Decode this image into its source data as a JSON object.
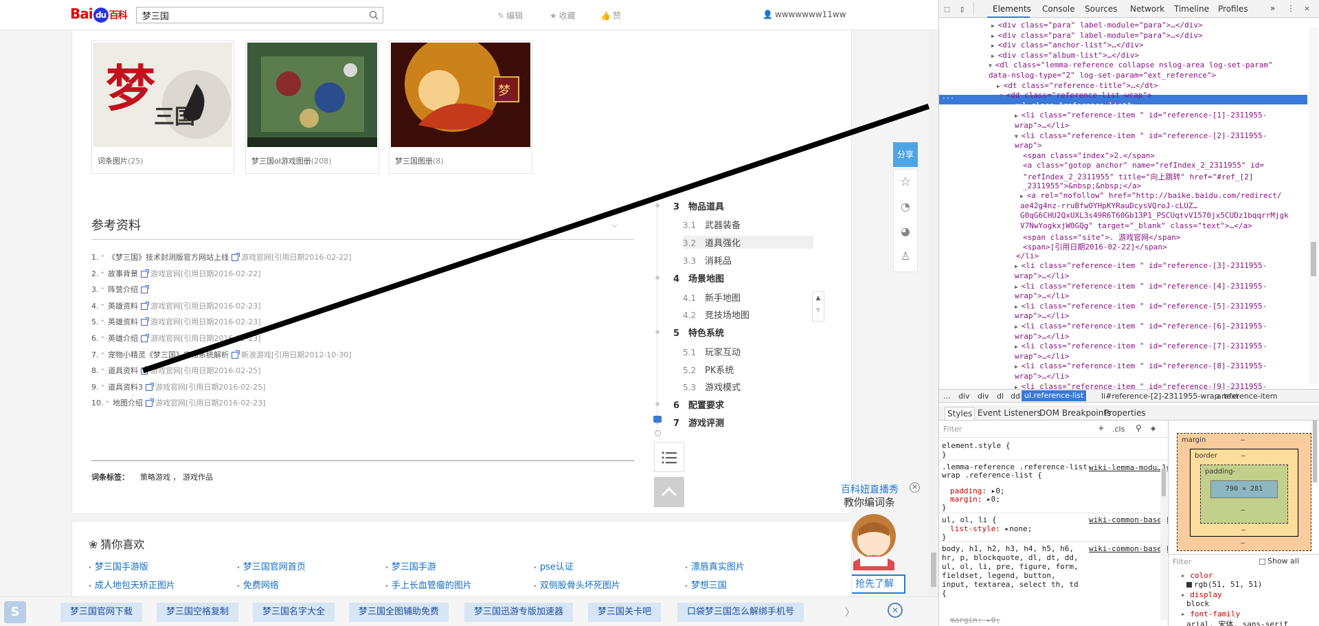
{
  "topbar": {
    "logo": "Bai",
    "logo_du": "du",
    "logo_baike": "百科",
    "search_value": "梦三国",
    "edit_label": "编辑",
    "favorite_label": "收藏",
    "like_label": "赞",
    "username": "wwwwwww11ww"
  },
  "albums": [
    {
      "caption": "词条图片",
      "count": "(25)"
    },
    {
      "caption": "梦三国ol游戏图册",
      "count": "(208)"
    },
    {
      "caption": "梦三国图册",
      "count": "(8)"
    }
  ],
  "references": {
    "title": "参考资料",
    "items": [
      {
        "num": "1.",
        "text": "《梦三国》技术封测版官方网站上线",
        "site": "游戏官网[引用日期2016-02-22]"
      },
      {
        "num": "2.",
        "text": "故事背景",
        "site": "游戏官网[引用日期2016-02-22]"
      },
      {
        "num": "3.",
        "text": "阵营介绍",
        "site": ""
      },
      {
        "num": "4.",
        "text": "英雄资料",
        "site": "游戏官网[引用日期2016-02-23]"
      },
      {
        "num": "5.",
        "text": "英雄资料",
        "site": "游戏官网[引用日期2016-02-23]"
      },
      {
        "num": "6.",
        "text": "英雄介绍",
        "site": "游戏官网[引用日期2016-02-23]"
      },
      {
        "num": "7.",
        "text": "宠物小精灵《梦三国》宠物系统解析",
        "site": "新浪游戏[引用日期2012-10-30]"
      },
      {
        "num": "8.",
        "text": "道具资料",
        "site": "游戏官网[引用日期2016-02-25]"
      },
      {
        "num": "9.",
        "text": "道具资料3",
        "site": "游戏官网[引用日期2016-02-25]"
      },
      {
        "num": "10.",
        "text": "地图介绍",
        "site": "游戏官网[引用日期2016-02-23]"
      }
    ]
  },
  "tags": {
    "label": "词条标签：",
    "values": "策略游戏 ， 游戏作品"
  },
  "toc": {
    "sections": [
      {
        "num": "3",
        "label": "物品道具",
        "minor": false
      },
      {
        "num": "3.1",
        "label": "武器装备",
        "minor": true
      },
      {
        "num": "3.2",
        "label": "道具强化",
        "minor": true
      },
      {
        "num": "3.3",
        "label": "消耗品",
        "minor": true
      },
      {
        "num": "4",
        "label": "场景地图",
        "minor": false
      },
      {
        "num": "4.1",
        "label": "新手地图",
        "minor": true
      },
      {
        "num": "4.2",
        "label": "竞技场地图",
        "minor": true
      },
      {
        "num": "5",
        "label": "特色系统",
        "minor": false
      },
      {
        "num": "5.1",
        "label": "玩家互动",
        "minor": true
      },
      {
        "num": "5.2",
        "label": "PK系统",
        "minor": true
      },
      {
        "num": "5.3",
        "label": "游戏模式",
        "minor": true
      },
      {
        "num": "6",
        "label": "配置要求",
        "minor": false
      },
      {
        "num": "7",
        "label": "游戏评测",
        "minor": false
      }
    ]
  },
  "share": {
    "label": "分享"
  },
  "live": {
    "title": "百科妞直播秀",
    "subtitle": "教你编词条",
    "button": "抢先了解"
  },
  "guess": {
    "title": "猜你喜欢",
    "links": [
      "梦三国手游版",
      "梦三国官网首页",
      "梦三国手游",
      "pse认证",
      "漂唇真实图片",
      "成人地包天矫正图片",
      "免费网络",
      "手上长血管瘤的图片",
      "双侧股骨头坏死图片",
      "梦想三国"
    ]
  },
  "bottombar": {
    "chips": [
      "梦三国官网下载",
      "梦三国空格复制",
      "梦三国名字大全",
      "梦三国全图辅助免费",
      "梦三国迅游专版加速器",
      "梦三国关卡吧",
      "口袋梦三国怎么解绑手机号"
    ]
  },
  "devtools": {
    "tabs": [
      "Elements",
      "Console",
      "Sources",
      "Network",
      "Timeline",
      "Profiles"
    ],
    "more": "»",
    "breadcrumbs": [
      "...",
      "div",
      "div",
      "dl",
      "dd",
      "ul.reference-list",
      "li#reference-[2]-2311955-wrap.reference-item",
      "a.text"
    ],
    "subtabs": [
      "Styles",
      "Event Listeners",
      "DOM Breakpoints",
      "Properties"
    ],
    "filter": "Filter",
    "cls": ".cls",
    "element_style": "element.style {",
    "rule1_selector": ".lemma-reference .reference-list-wrap .reference-list {",
    "rule1_source": "wiki-lemma-modu…1dc9f64.css:28",
    "rule1_p1": "padding",
    "rule1_v1": "0;",
    "rule1_p2": "margin",
    "rule1_v2": "0;",
    "rule2_selector": "ul, ol, li {",
    "rule2_source": "wiki-common-base_b4e62b7.css:1",
    "rule2_p1": "list-style",
    "rule2_v1": "none;",
    "rule3_selector": "body, h1, h2, h3, h4, h5, h6, hr, p, blockquote, dl, dt, dd, ul, ol, li, pre, figure, form, fieldset, legend, button, input, textarea, select th, td {",
    "rule3_source": "wiki-common-base_b4e62b7.css:1",
    "rule3_p1": "margin",
    "rule3_v1": "0;",
    "box": {
      "margin": "margin",
      "border": "border",
      "padding": "padding-",
      "size": "790 × 281",
      "dash": "–"
    },
    "computed_filter": "Filter",
    "show_all": "Show all",
    "computed": [
      {
        "prop": "color",
        "val": "rgb(51, 51, 51)"
      },
      {
        "prop": "display",
        "val": "block"
      },
      {
        "prop": "font-family",
        "val": "arial, 宋体, sans-serif"
      }
    ],
    "dom_lines": [
      "<div class=\"para\" label-module=\"para\">…</div>",
      "<div class=\"para\" label-module=\"para\">…</div>",
      "<div class=\"anchor-list\">…</div>",
      "<div class=\"album-list\">…</div>",
      "<dl class=\"lemma-reference collapse nslog-area log-set-param\"",
      "data-nslog-type=\"2\" log-set-param=\"ext_reference\">",
      "<dt class=\"reference-title\">…</dt>",
      "<dd class=\"reference-list-wrap\">",
      "<ul class=\"reference-list\">",
      "<li class=\"reference-item \" id=\"reference-[1]-2311955-",
      "wrap\">…</li>",
      "<li class=\"reference-item \" id=\"reference-[2]-2311955-",
      "wrap\">",
      "<span class=\"index\">2.</span>",
      "<a class=\"gotop anchor\" name=\"refIndex_2_2311955\" id=",
      "\"refIndex_2_2311955\" title=\"向上跳转\" href=\"#ref_[2]",
      "_2311955\">&nbsp;&nbsp;</a>",
      "<a rel=\"nofollow\" href=\"http://baike.baidu.com/redirect/",
      "ae42g4nz-rruBfwOYHpKYRauDcysVQroJ-cLUZ…",
      "G0qG6CHU2QxUXL3s49R6T60Gb13P1_PSCUqtvV1570jx5CUDz1bqqrrMjgk",
      "V7NwYogkxjW0GQg\" target=\"_blank\" class=\"text\">…</a>",
      "<span class=\"site\">. 游戏官网</span>",
      "<span>[引用日期2016-02-22]</span>",
      "</li>",
      "<li class=\"reference-item \" id=\"reference-[3]-2311955-",
      "wrap\">…</li>",
      "<li class=\"reference-item \" id=\"reference-[4]-2311955-",
      "wrap\">…</li>",
      "<li class=\"reference-item \" id=\"reference-[5]-2311955-",
      "wrap\">…</li>",
      "<li class=\"reference-item \" id=\"reference-[6]-2311955-",
      "wrap\">…</li>",
      "<li class=\"reference-item \" id=\"reference-[7]-2311955-",
      "wrap\">…</li>",
      "<li class=\"reference-item \" id=\"reference-[8]-2311955-",
      "wrap\">…</li>",
      "<li class=\"reference-item \" id=\"reference-[9]-2311955-",
      "wrap\">…</li>"
    ]
  }
}
